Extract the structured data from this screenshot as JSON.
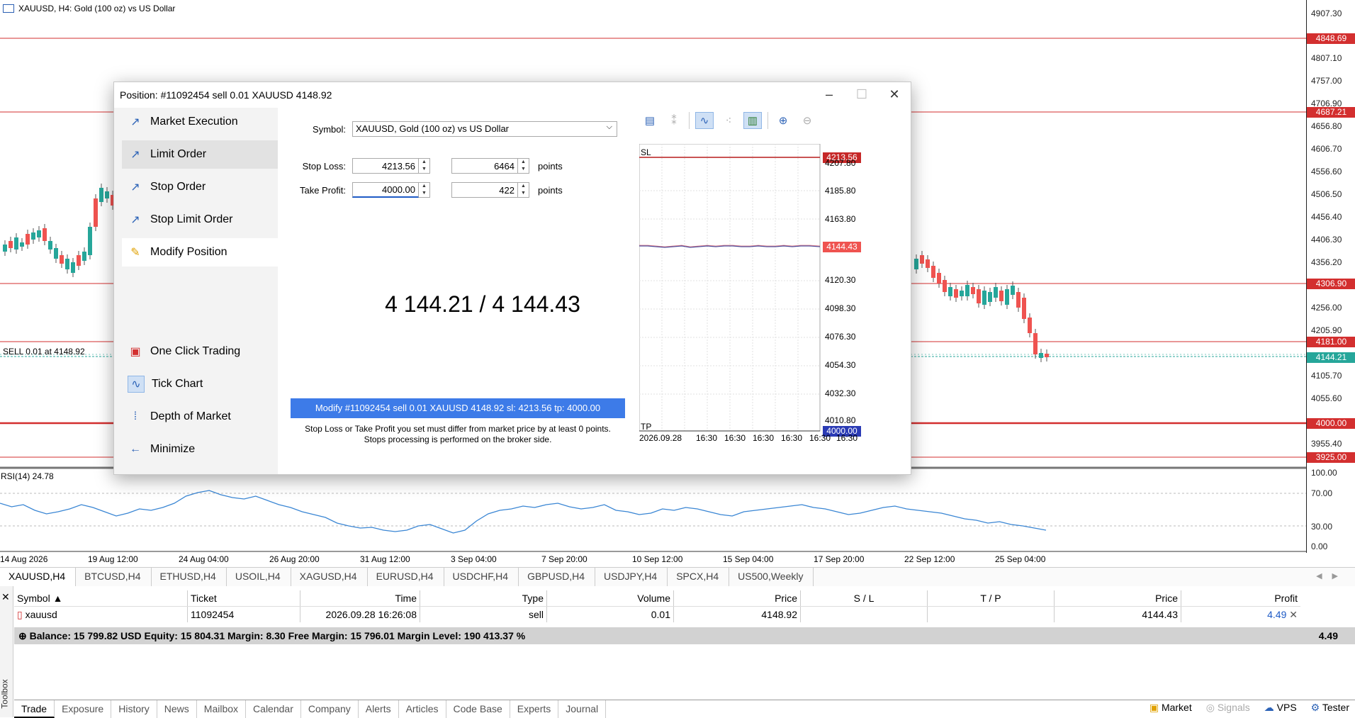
{
  "chart": {
    "title": "XAUUSD, H4:  Gold (100 oz) vs US Dollar",
    "sell_label": "SELL 0.01 at 4148.92",
    "rsi_label": "RSI(14) 24.78",
    "price_labels": [
      "4907.30",
      "4807.10",
      "4757.00",
      "4706.90",
      "4656.80",
      "4606.70",
      "4556.60",
      "4506.50",
      "4456.40",
      "4406.30",
      "4356.20",
      "4256.00",
      "4205.90",
      "4105.70",
      "4055.60",
      "3955.40"
    ],
    "price_tags": [
      {
        "text": "4848.69",
        "color": "#d32f2f"
      },
      {
        "text": "4687.21",
        "color": "#d32f2f"
      },
      {
        "text": "4306.90",
        "color": "#d32f2f"
      },
      {
        "text": "4181.00",
        "color": "#d32f2f"
      },
      {
        "text": "4144.21",
        "color": "#26a69a"
      },
      {
        "text": "4000.00",
        "color": "#d32f2f"
      },
      {
        "text": "3925.00",
        "color": "#d32f2f"
      }
    ],
    "rsi_labels": [
      "100.00",
      "70.00",
      "30.00",
      "0.00"
    ],
    "time_labels": [
      "14 Aug 2026",
      "19 Aug 12:00",
      "24 Aug 04:00",
      "26 Aug 20:00",
      "31 Aug 12:00",
      "3 Sep 04:00",
      "7 Sep 20:00",
      "10 Sep 12:00",
      "15 Sep 04:00",
      "17 Sep 20:00",
      "22 Sep 12:00",
      "25 Sep 04:00"
    ]
  },
  "symbol_tabs": [
    "XAUUSD,H4",
    "BTCUSD,H4",
    "ETHUSD,H4",
    "USOIL,H4",
    "XAGUSD,H4",
    "EURUSD,H4",
    "USDCHF,H4",
    "GBPUSD,H4",
    "USDJPY,H4",
    "SPCX,H4",
    "US500,Weekly"
  ],
  "trade_table": {
    "headers": [
      "Symbol",
      "Ticket",
      "Time",
      "Type",
      "Volume",
      "Price",
      "S / L",
      "T / P",
      "Price",
      "Profit"
    ],
    "row": {
      "symbol": "xauusd",
      "ticket": "11092454",
      "time": "2026.09.28 16:26:08",
      "type": "sell",
      "volume": "0.01",
      "open_price": "4148.92",
      "sl": "",
      "tp": "",
      "price": "4144.43",
      "profit": "4.49"
    },
    "balance_text": "Balance: 15 799.82 USD  Equity: 15 804.31  Margin: 8.30  Free Margin: 15 796.01  Margin Level: 190 413.37 %",
    "balance_profit": "4.49"
  },
  "toolbox_label": "Toolbox",
  "bottom_tabs": [
    "Trade",
    "Exposure",
    "History",
    "News",
    "Mailbox",
    "Calendar",
    "Company",
    "Alerts",
    "Articles",
    "Code Base",
    "Experts",
    "Journal"
  ],
  "status_right": [
    "Market",
    "Signals",
    "VPS",
    "Tester"
  ],
  "dialog": {
    "title": "Position: #11092454 sell 0.01 XAUUSD 4148.92",
    "side_menu": [
      "Market Execution",
      "Limit Order",
      "Stop Order",
      "Stop Limit Order",
      "Modify Position",
      "One Click Trading",
      "Tick Chart",
      "Depth of Market",
      "Minimize"
    ],
    "symbol_label": "Symbol:",
    "symbol_value": "XAUUSD, Gold (100 oz) vs US Dollar",
    "stop_loss_label": "Stop Loss:",
    "stop_loss_value": "4213.56",
    "stop_loss_points": "6464",
    "take_profit_label": "Take Profit:",
    "take_profit_value": "4000.00",
    "take_profit_points": "422",
    "points_label": "points",
    "quote": "4 144.21 / 4 144.43",
    "modify_button": "Modify #11092454 sell 0.01 XAUUSD 4148.92 sl: 4213.56 tp: 4000.00",
    "note_line1": "Stop Loss or Take Profit you set must differ from market price by at least 0 points.",
    "note_line2": "Stops processing is performed on the broker side.",
    "tick_chart": {
      "sl_label": "SL",
      "tp_label": "TP",
      "price_labels": [
        "4207.80",
        "4185.80",
        "4163.80",
        "4120.30",
        "4098.30",
        "4076.30",
        "4054.30",
        "4032.30",
        "4010.80"
      ],
      "sl_tag": "4213.56",
      "bid_tag": "4144.43",
      "tp_tag": "4000.00",
      "time_labels": [
        "2026.09.28",
        "16:30",
        "16:30",
        "16:30",
        "16:30",
        "16:30",
        "16:30"
      ]
    }
  }
}
